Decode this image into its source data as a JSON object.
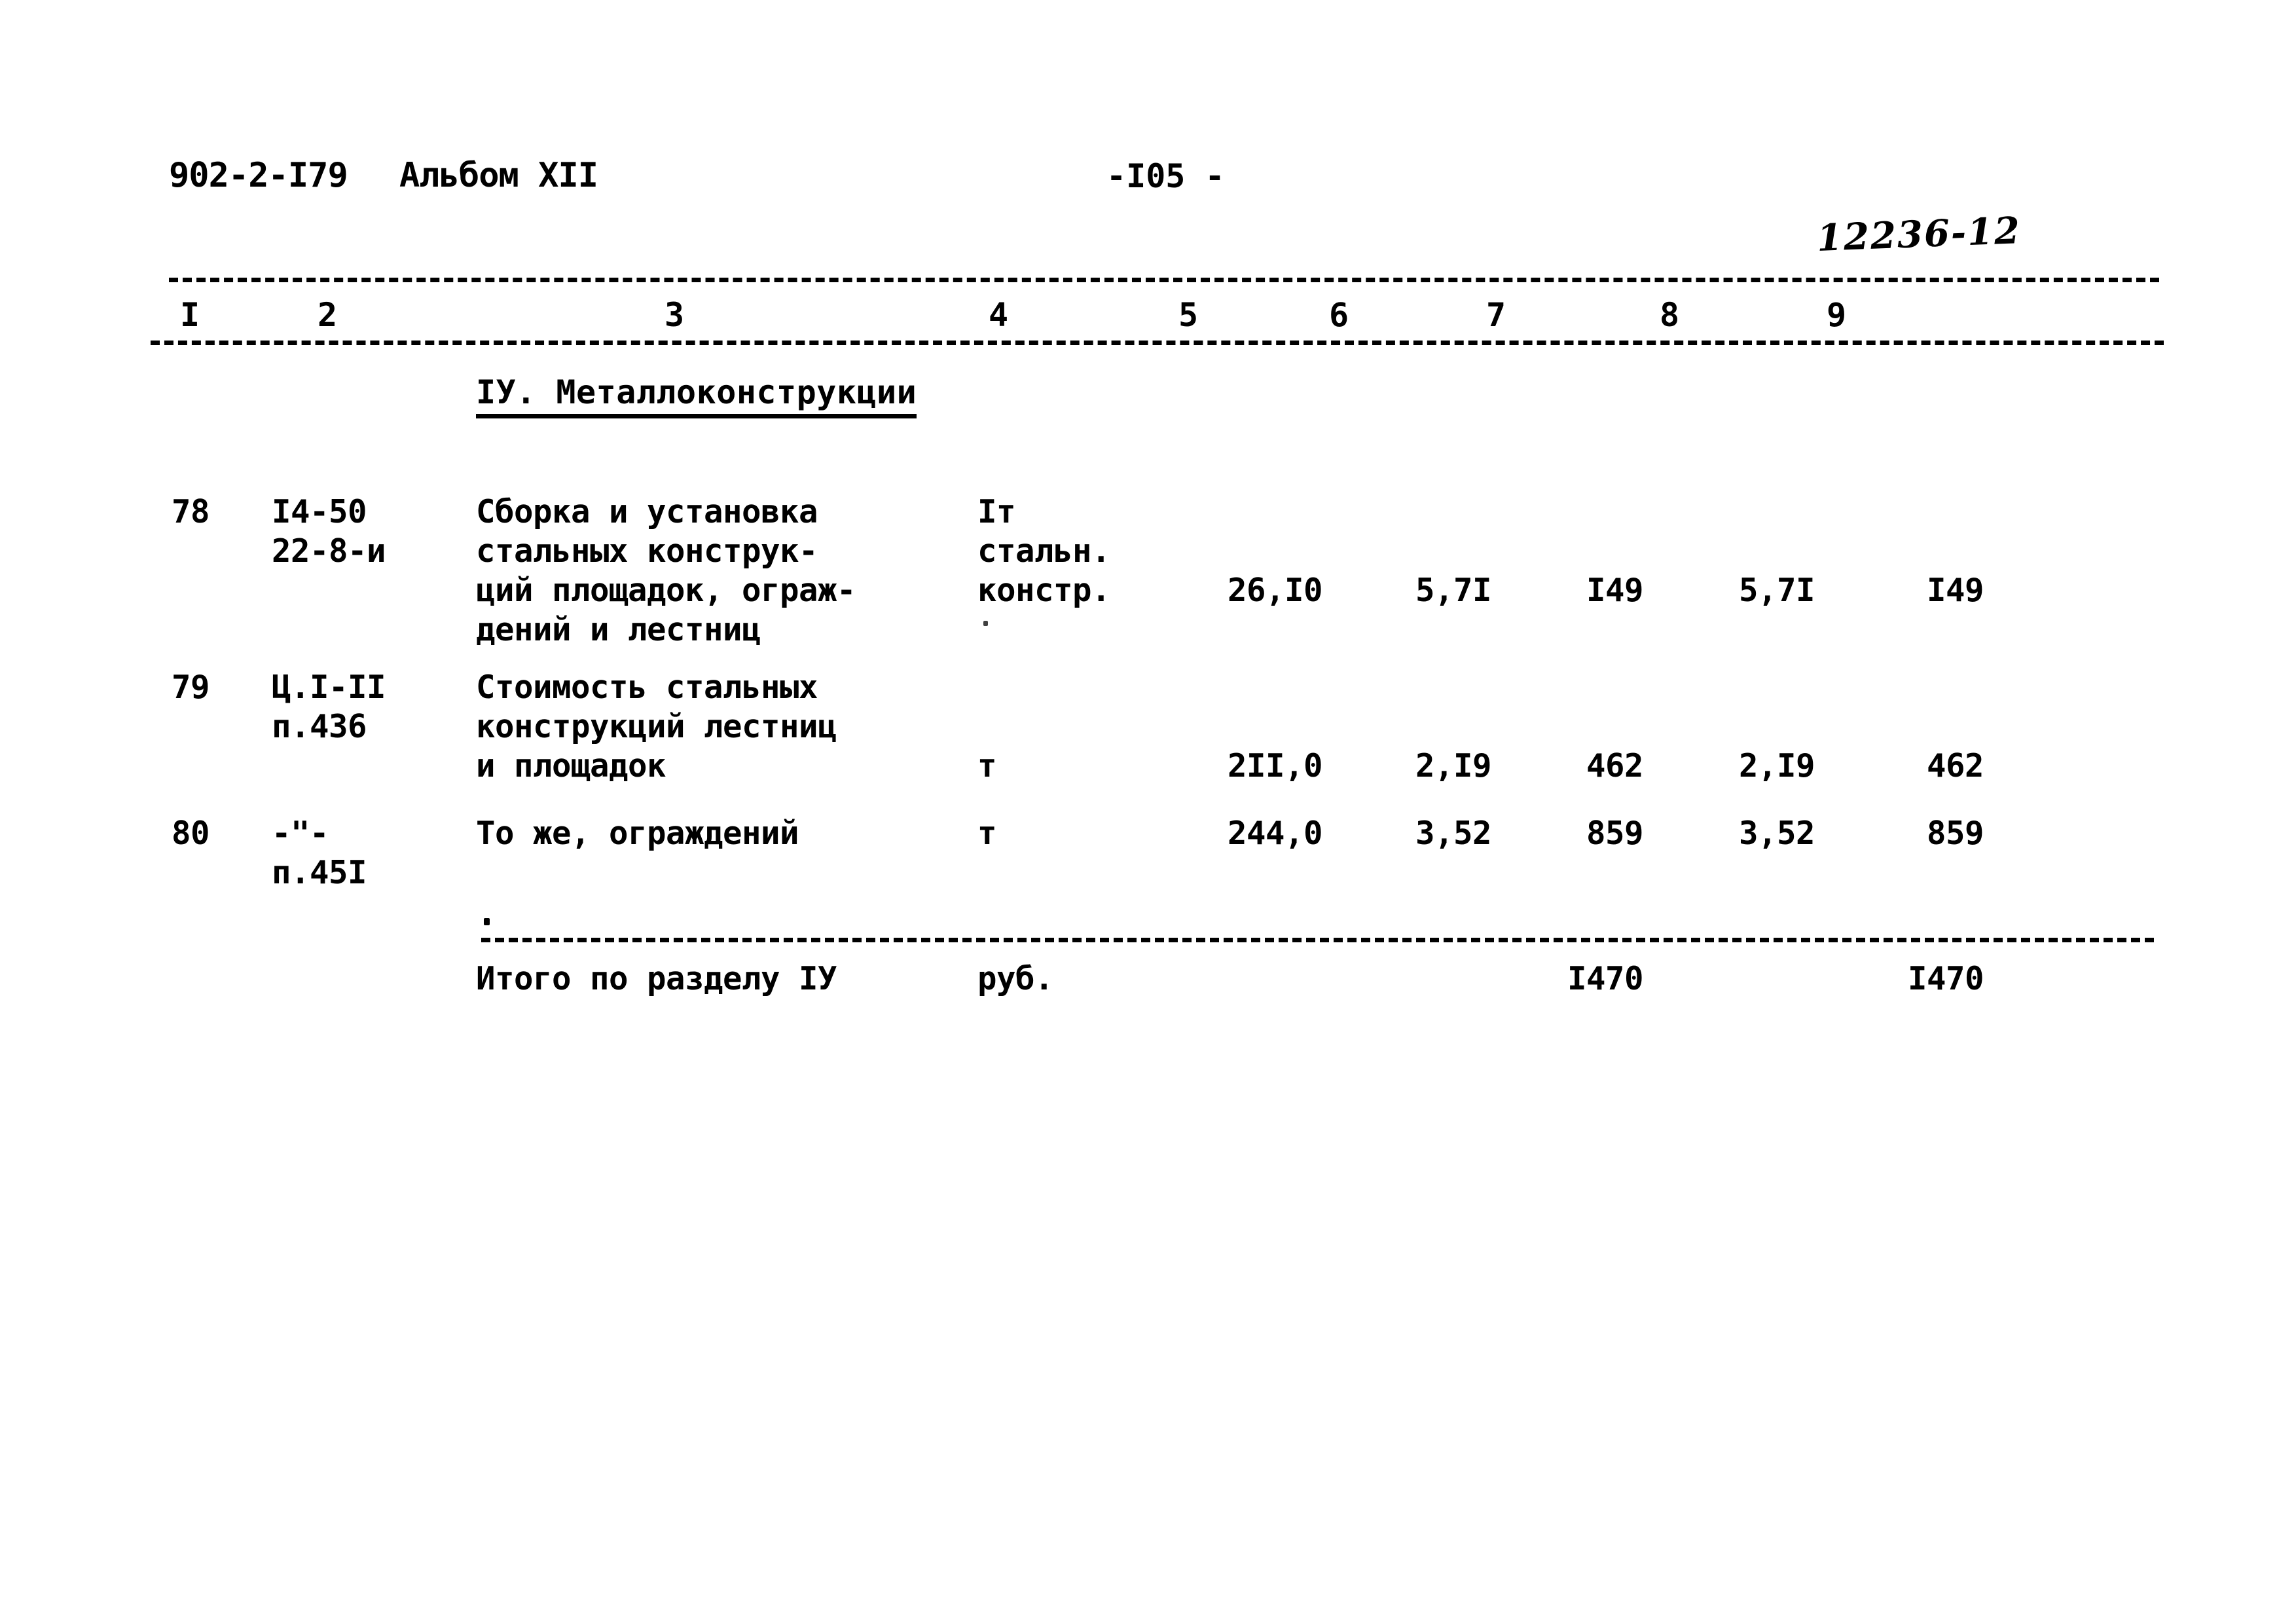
{
  "header": {
    "document_code": "902-2-I79",
    "album": "Альбом XII",
    "page_number": "-I05 -",
    "handwritten_note": "12236-12"
  },
  "table": {
    "column_numbers": [
      "I",
      "2",
      "3",
      "4",
      "5",
      "6",
      "7",
      "8",
      "9"
    ],
    "section_heading": "IУ. Металлоконструкции",
    "rows": [
      {
        "num": "78",
        "code_line1": "I4-50",
        "code_line2": "22-8-и",
        "desc_line1": "Сборка и установка",
        "desc_line2": "стальных конструк-",
        "desc_line3": "ций площадок, ограж-",
        "desc_line4": "дений и лестниц",
        "unit_line1": "Iт",
        "unit_line2": "стальн.",
        "unit_line3": "констр.",
        "col5": "26,I0",
        "col6": "5,7I",
        "col7": "I49",
        "col8": "5,7I",
        "col9": "I49"
      },
      {
        "num": "79",
        "code_line1": "Ц.I-II",
        "code_line2": "п.436",
        "desc_line1": "Стоимость стальных",
        "desc_line2": "конструкций лестниц",
        "desc_line3": "и площадок",
        "desc_line4": "",
        "unit_line1": "т",
        "unit_line2": "",
        "unit_line3": "",
        "col5": "2II,0",
        "col6": "2,I9",
        "col7": "462",
        "col8": "2,I9",
        "col9": "462"
      },
      {
        "num": "80",
        "code_line1": "-\"-",
        "code_line2": "п.45I",
        "desc_line1": "То же, ограждений",
        "desc_line2": "",
        "desc_line3": "",
        "desc_line4": "",
        "unit_line1": "т",
        "unit_line2": "",
        "unit_line3": "",
        "col5": "244,0",
        "col6": "3,52",
        "col7": "859",
        "col8": "3,52",
        "col9": "859"
      }
    ],
    "total": {
      "label": "Итого по разделу IУ",
      "unit": "руб.",
      "col7": "I470",
      "col9": "I470"
    }
  }
}
